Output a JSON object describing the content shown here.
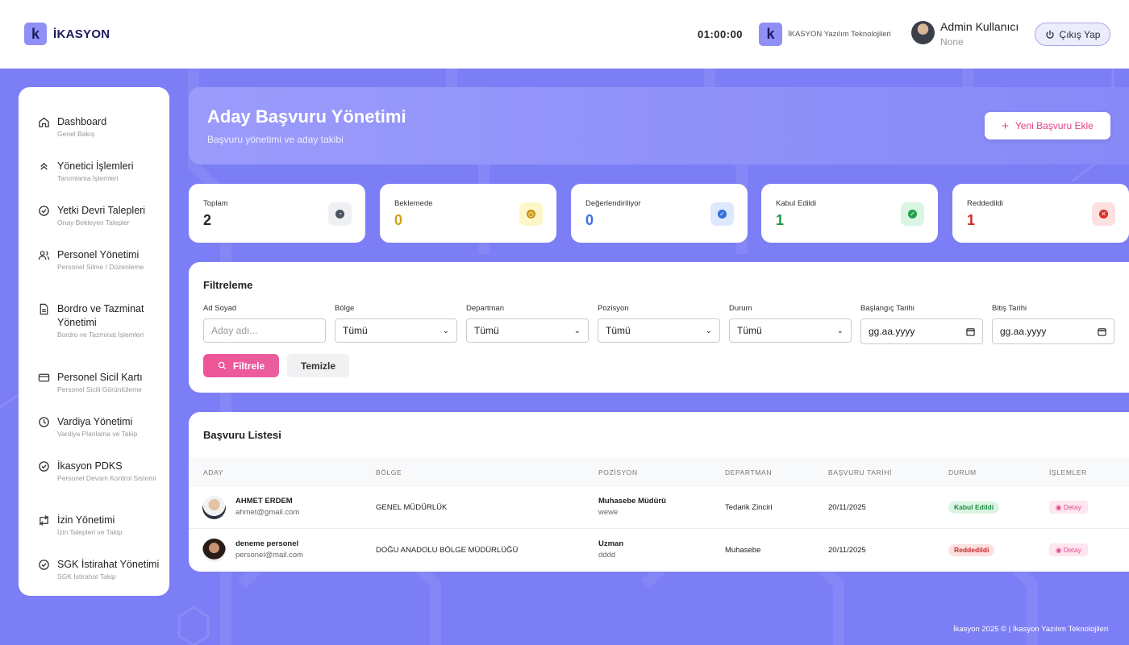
{
  "app": {
    "logo_letter": "k",
    "name": "İKASYON"
  },
  "topbar": {
    "timer": "01:00:00",
    "company_name": "İKASYON Yazılım Teknolojileri",
    "user_name": "Admin Kullanıcı",
    "user_role": "None",
    "logout_label": "Çıkış Yap"
  },
  "sidebar": {
    "items": [
      {
        "label": "Dashboard",
        "sub": "Genel Bakış",
        "icon": "home-icon"
      },
      {
        "label": "Yönetici İşlemleri",
        "sub": "Tanımlama İşlemleri",
        "icon": "chevrons-up-icon"
      },
      {
        "label": "Yetki Devri Talepleri",
        "sub": "Onay Bekleyen Talepler",
        "icon": "check-circle-icon"
      },
      {
        "label": "Personel Yönetimi",
        "sub": "Personel Silme / Düzenleme",
        "icon": "users-icon"
      },
      {
        "label": "Bordro ve Tazminat Yönetimi",
        "sub": "Bordro ve Tazminat İşlemleri",
        "icon": "document-icon"
      },
      {
        "label": "Personel Sicil Kartı",
        "sub": "Personel Sicili Görüntüleme",
        "icon": "card-icon"
      },
      {
        "label": "Vardiya Yönetimi",
        "sub": "Vardiya Planlama ve Takip",
        "icon": "clock-icon"
      },
      {
        "label": "İkasyon PDKS",
        "sub": "Personel Devam Kontrol Sistemi",
        "icon": "check-circle-icon"
      },
      {
        "label": "İzin Yönetimi",
        "sub": "İzin Talepleri ve Takip",
        "icon": "swap-icon"
      },
      {
        "label": "SGK İstirahat Yönetimi",
        "sub": "SGK İstirahat Takip",
        "icon": "check-circle-icon"
      }
    ]
  },
  "header": {
    "title": "Aday Başvuru Yönetimi",
    "subtitle": "Başvuru yönetimi ve aday takibi",
    "new_button": "Yeni Başvuru Ekle"
  },
  "stats": [
    {
      "title": "Toplam",
      "value": "2",
      "color": "#1f2230",
      "icon_bg": "#eef0f4",
      "icon_color": "#4b5563",
      "icon": "gauge-icon"
    },
    {
      "title": "Beklemede",
      "value": "0",
      "color": "#d1a016",
      "icon_bg": "#fdf6c8",
      "icon_color": "#c7940c",
      "icon": "clock-icon"
    },
    {
      "title": "Değerlendiriliyor",
      "value": "0",
      "color": "#3b6fe0",
      "icon_bg": "#dce8fb",
      "icon_color": "#2f6fe0",
      "icon": "check-icon"
    },
    {
      "title": "Kabul Edildi",
      "value": "1",
      "color": "#1e9a4a",
      "icon_bg": "#daf5e2",
      "icon_color": "#1fa24b",
      "icon": "check-icon"
    },
    {
      "title": "Reddedildi",
      "value": "1",
      "color": "#d12b2b",
      "icon_bg": "#fde1e1",
      "icon_color": "#d92c2c",
      "icon": "x-icon"
    }
  ],
  "filter": {
    "title": "Filtreleme",
    "fields": [
      {
        "label": "Ad Soyad",
        "value": "Aday adı...",
        "type": "input"
      },
      {
        "label": "Bölge",
        "value": "Tümü",
        "type": "select"
      },
      {
        "label": "Departman",
        "value": "Tümü",
        "type": "select"
      },
      {
        "label": "Pozisyon",
        "value": "Tümü",
        "type": "select"
      },
      {
        "label": "Durum",
        "value": "Tümü",
        "type": "select"
      },
      {
        "label": "Başlangıç Tarihi",
        "value": "gg.aa.yyyy",
        "type": "date"
      },
      {
        "label": "Bitiş Tarihi",
        "value": "gg.aa.yyyy",
        "type": "date"
      }
    ],
    "filter_button": "Filtrele",
    "clear_button": "Temizle"
  },
  "list": {
    "title": "Başvuru Listesi",
    "columns": [
      "ADAY",
      "BÖLGE",
      "POZİSYON",
      "DEPARTMAN",
      "BAŞVURU TARİHİ",
      "DURUM",
      "İŞLEMLER"
    ],
    "rows": [
      {
        "name": "AHMET ERDEM",
        "email": "ahmet@gmail.com",
        "region": "GENEL MÜDÜRLÜK",
        "position": "Muhasebe Müdürü",
        "position_note": "wewe",
        "department": "Tedarik Zinciri",
        "date": "20/11/2025",
        "status": "Kabul Edildi",
        "status_bg": "#dcf5e3",
        "status_color": "#1e8a44",
        "action": "Detay"
      },
      {
        "name": "deneme personel",
        "email": "personel@mail.com",
        "region": "DOĞU ANADOLU BÖLGE MÜDÜRLÜĞÜ",
        "position": "Uzman",
        "position_note": "dddd",
        "department": "Muhasebe",
        "date": "20/11/2025",
        "status": "Reddedildi",
        "status_bg": "#fde0e0",
        "status_color": "#c72a2a",
        "action": "Detay"
      }
    ]
  },
  "footer": {
    "text": "İkasyon 2025 © | İkasyon Yazılım Teknolojileri"
  }
}
